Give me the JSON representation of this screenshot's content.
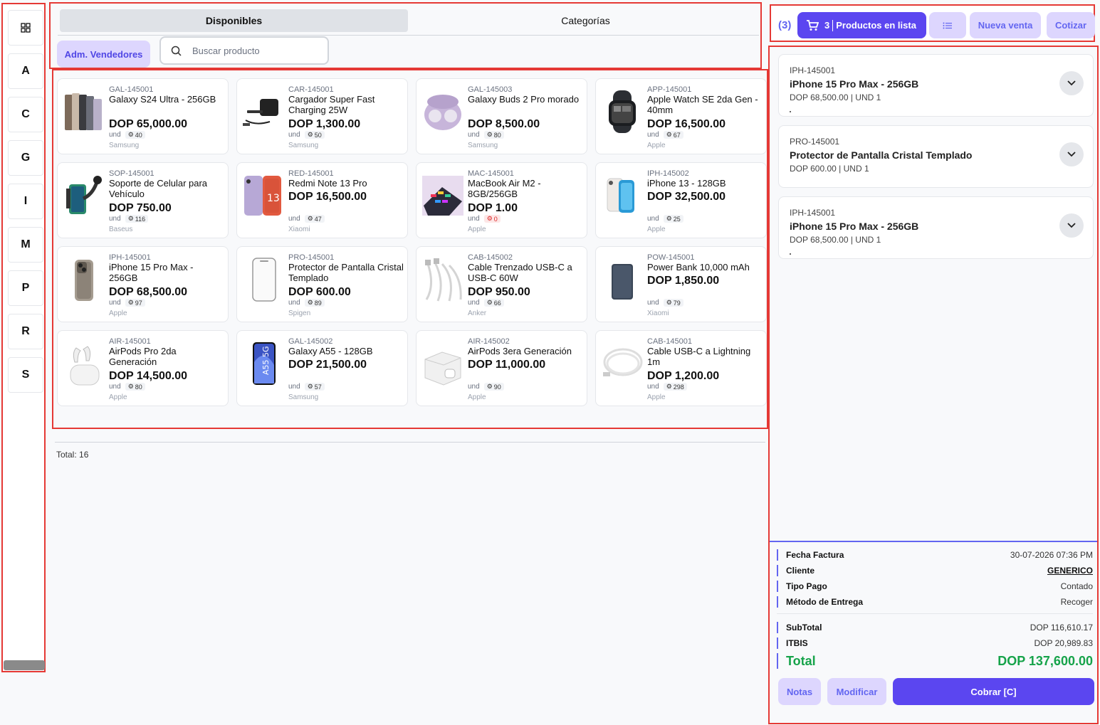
{
  "letter_nav": {
    "items": [
      "A",
      "C",
      "G",
      "I",
      "M",
      "P",
      "R",
      "S"
    ]
  },
  "tabs": {
    "available": "Disponibles",
    "categories": "Categorías"
  },
  "toolbar": {
    "sellers_label": "Adm. Vendedores",
    "search_placeholder": "Buscar producto"
  },
  "products": [
    {
      "code": "GAL-145001",
      "name": "Galaxy S24 Ultra - 256GB",
      "price": "DOP 65,000.00",
      "unit": "und",
      "stock": "40",
      "brand": "Samsung"
    },
    {
      "code": "CAR-145001",
      "name": "Cargador Super Fast Charging 25W",
      "price": "DOP 1,300.00",
      "unit": "und",
      "stock": "50",
      "brand": "Samsung"
    },
    {
      "code": "GAL-145003",
      "name": "Galaxy Buds 2 Pro morado",
      "price": "DOP 8,500.00",
      "unit": "und",
      "stock": "80",
      "brand": "Samsung"
    },
    {
      "code": "APP-145001",
      "name": "Apple Watch SE 2da Gen - 40mm",
      "price": "DOP 16,500.00",
      "unit": "und",
      "stock": "67",
      "brand": "Apple"
    },
    {
      "code": "SOP-145001",
      "name": "Soporte de Celular para Vehículo",
      "price": "DOP 750.00",
      "unit": "und",
      "stock": "116",
      "brand": "Baseus"
    },
    {
      "code": "RED-145001",
      "name": "Redmi Note 13 Pro",
      "price": "DOP 16,500.00",
      "unit": "und",
      "stock": "47",
      "brand": "Xiaomi"
    },
    {
      "code": "MAC-145001",
      "name": "MacBook Air M2 - 8GB/256GB",
      "price": "DOP 1.00",
      "unit": "und",
      "stock": "0",
      "brand": "Apple"
    },
    {
      "code": "IPH-145002",
      "name": "iPhone 13 - 128GB",
      "price": "DOP 32,500.00",
      "unit": "und",
      "stock": "25",
      "brand": "Apple"
    },
    {
      "code": "IPH-145001",
      "name": "iPhone 15 Pro Max - 256GB",
      "price": "DOP 68,500.00",
      "unit": "und",
      "stock": "97",
      "brand": "Apple"
    },
    {
      "code": "PRO-145001",
      "name": "Protector de Pantalla Cristal Templado",
      "price": "DOP 600.00",
      "unit": "und",
      "stock": "89",
      "brand": "Spigen"
    },
    {
      "code": "CAB-145002",
      "name": "Cable Trenzado USB-C a USB-C 60W",
      "price": "DOP 950.00",
      "unit": "und",
      "stock": "66",
      "brand": "Anker"
    },
    {
      "code": "POW-145001",
      "name": "Power Bank 10,000 mAh",
      "price": "DOP 1,850.00",
      "unit": "und",
      "stock": "79",
      "brand": "Xiaomi"
    },
    {
      "code": "AIR-145001",
      "name": "AirPods Pro 2da Generación",
      "price": "DOP 14,500.00",
      "unit": "und",
      "stock": "80",
      "brand": "Apple"
    },
    {
      "code": "GAL-145002",
      "name": "Galaxy A55 - 128GB",
      "price": "DOP 21,500.00",
      "unit": "und",
      "stock": "57",
      "brand": "Samsung"
    },
    {
      "code": "AIR-145002",
      "name": "AirPods 3era Generación",
      "price": "DOP 11,000.00",
      "unit": "und",
      "stock": "90",
      "brand": "Apple"
    },
    {
      "code": "CAB-145001",
      "name": "Cable USB-C a Lightning 1m",
      "price": "DOP 1,200.00",
      "unit": "und",
      "stock": "298",
      "brand": "Apple"
    }
  ],
  "total_label": "Total: 16",
  "cart_header": {
    "count": "(3)",
    "list_count": "3",
    "list_label": "Productos en lista",
    "new_sale": "Nueva venta",
    "quote": "Cotizar"
  },
  "cart_items": [
    {
      "code": "IPH-145001",
      "name": "iPhone 15 Pro Max - 256GB",
      "meta": "DOP 68,500.00 | UND 1"
    },
    {
      "code": "PRO-145001",
      "name": "Protector de Pantalla Cristal Templado",
      "meta": "DOP 600.00 | UND 1"
    },
    {
      "code": "IPH-145001",
      "name": "iPhone 15 Pro Max - 256GB",
      "meta": "DOP 68,500.00 | UND 1"
    }
  ],
  "summary": {
    "invoice_date_label": "Fecha Factura",
    "invoice_date": "30-07-2026 07:36 PM",
    "client_label": "Cliente",
    "client": "GENERICO",
    "payment_type_label": "Tipo Pago",
    "payment_type": "Contado",
    "delivery_label": "Método de Entrega",
    "delivery": "Recoger",
    "subtotal_label": "SubTotal",
    "subtotal": "DOP 116,610.17",
    "itbis_label": "ITBIS",
    "itbis": "DOP 20,989.83",
    "total_label": "Total",
    "total": "DOP 137,600.00"
  },
  "actions": {
    "notes": "Notas",
    "modify": "Modificar",
    "charge": "Cobrar [C]"
  },
  "colors": {
    "accent": "#5b46f0",
    "accent_soft": "#ddd6fe",
    "total_green": "#16a34a"
  }
}
